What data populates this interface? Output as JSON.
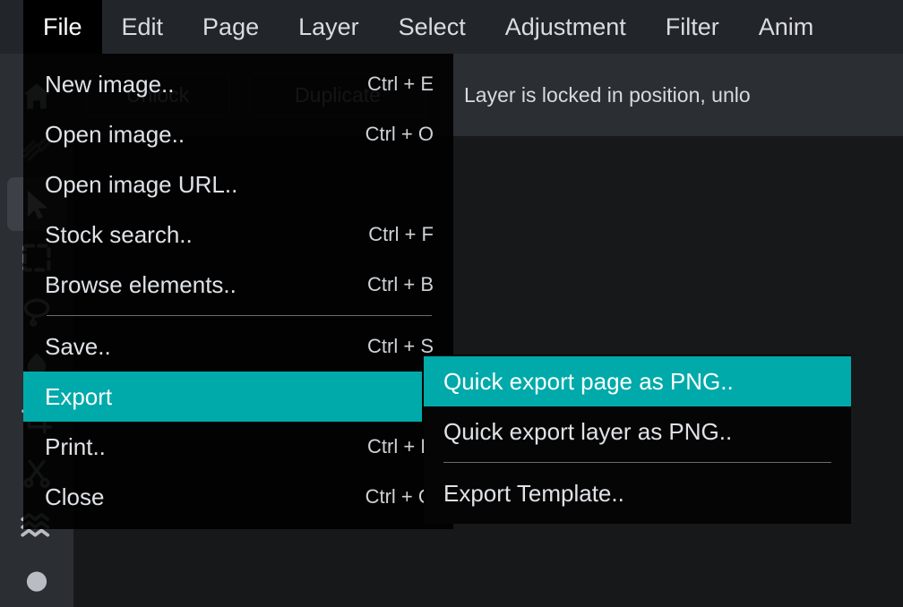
{
  "app": {
    "accent_color": "#00aaaa",
    "menubar_bg": "#222529",
    "panel_bg": "#2b2e33",
    "canvas_bg": "#17181a",
    "menu_bg": "#000000"
  },
  "menubar": {
    "items": [
      {
        "label": "File",
        "open": true
      },
      {
        "label": "Edit",
        "open": false
      },
      {
        "label": "Page",
        "open": false
      },
      {
        "label": "Layer",
        "open": false
      },
      {
        "label": "Select",
        "open": false
      },
      {
        "label": "Adjustment",
        "open": false
      },
      {
        "label": "Filter",
        "open": false
      },
      {
        "label": "Anim",
        "open": false
      }
    ]
  },
  "toolbar": {
    "unlock_label": "Unlock",
    "duplicate_label": "Duplicate",
    "status_note": "Layer is locked in position, unlo"
  },
  "tool_rail": {
    "tools": [
      {
        "name": "home-icon",
        "active": false
      },
      {
        "name": "diagonal-lines-icon",
        "active": false
      },
      {
        "name": "cursor-pointer-icon",
        "active": true
      },
      {
        "name": "marquee-select-icon",
        "active": false
      },
      {
        "name": "lasso-select-icon",
        "active": false
      },
      {
        "name": "paint-drop-icon",
        "active": false
      },
      {
        "name": "crop-icon",
        "active": false
      },
      {
        "name": "scissors-icon",
        "active": false
      },
      {
        "name": "liquify-waves-icon",
        "active": false
      },
      {
        "name": "brush-icon",
        "active": false
      }
    ]
  },
  "file_menu": {
    "items": [
      {
        "label": "New image..",
        "accel": "Ctrl + E",
        "highlight": false,
        "separator_after": false,
        "submenu": false
      },
      {
        "label": "Open image..",
        "accel": "Ctrl + O",
        "highlight": false,
        "separator_after": false,
        "submenu": false
      },
      {
        "label": "Open image URL..",
        "accel": "",
        "highlight": false,
        "separator_after": false,
        "submenu": false
      },
      {
        "label": "Stock search..",
        "accel": "Ctrl + F",
        "highlight": false,
        "separator_after": false,
        "submenu": false
      },
      {
        "label": "Browse elements..",
        "accel": "Ctrl + B",
        "highlight": false,
        "separator_after": true,
        "submenu": false
      },
      {
        "label": "Save..",
        "accel": "Ctrl + S",
        "highlight": false,
        "separator_after": false,
        "submenu": false
      },
      {
        "label": "Export",
        "accel": "",
        "highlight": true,
        "separator_after": false,
        "submenu": true
      },
      {
        "label": "Print..",
        "accel": "Ctrl + P",
        "highlight": false,
        "separator_after": false,
        "submenu": false
      },
      {
        "label": "Close",
        "accel": "Ctrl + Q",
        "highlight": false,
        "separator_after": false,
        "submenu": false
      }
    ]
  },
  "export_submenu": {
    "items": [
      {
        "label": "Quick export page as PNG..",
        "highlight": true,
        "separator_after": false
      },
      {
        "label": "Quick export layer as PNG..",
        "highlight": false,
        "separator_after": true
      },
      {
        "label": "Export Template..",
        "highlight": false,
        "separator_after": false
      }
    ]
  }
}
